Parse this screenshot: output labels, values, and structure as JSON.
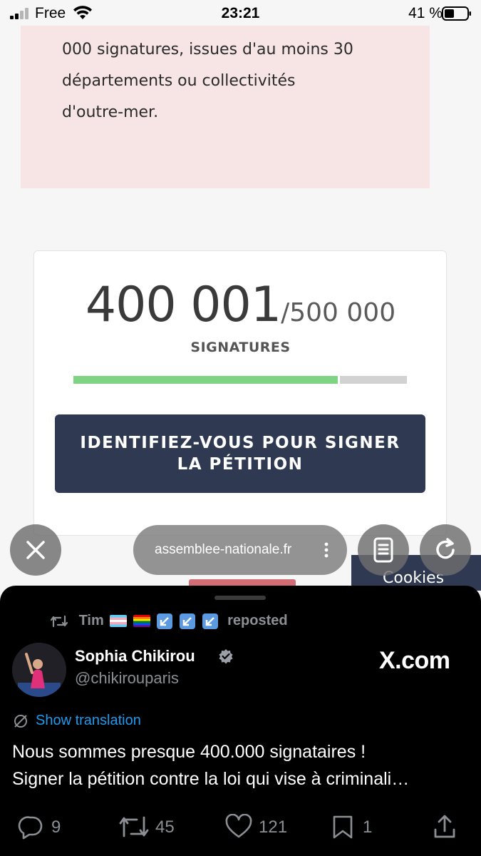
{
  "status_bar": {
    "carrier": "Free",
    "time": "23:21",
    "battery": "41 %"
  },
  "info": {
    "lines": [
      "000 signatures, issues d'au moins 30",
      "départements ou collectivités",
      "d'outre-mer."
    ]
  },
  "petition": {
    "count": "400 001",
    "goal": "/500 000",
    "label": "SIGNATURES",
    "progress_fraction": 0.8,
    "sign_button": "IDENTIFIEZ-VOUS POUR SIGNER LA PÉTITION"
  },
  "browser": {
    "url": "assemblee-nationale.fr",
    "cookies_label": "Cookies"
  },
  "tweet": {
    "reposted_by": "Tim",
    "reposted_label": "reposted",
    "author_name": "Sophia Chikirou",
    "author_handle": "@chikirouparis",
    "site": "X.com",
    "translation_label": "Show translation",
    "text_lines": [
      "Nous sommes presque 400.000 signataires !",
      "Signer la pétition contre la loi qui vise à criminali…"
    ],
    "replies": "9",
    "reposts": "45",
    "likes": "121",
    "bookmarks": "1"
  },
  "colors": {
    "info_bg": "#f7e5e5",
    "progress_fill": "#7fd483",
    "button_bg": "#2f3a52",
    "link_blue": "#1d9bf0"
  }
}
